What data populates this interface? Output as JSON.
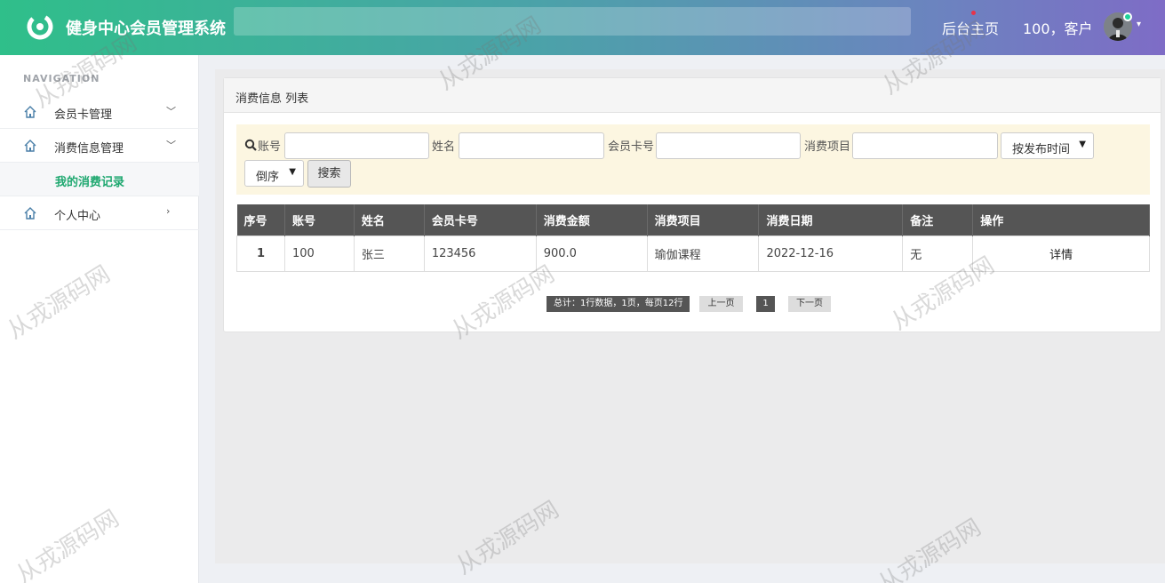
{
  "header": {
    "app_title": "健身中心会员管理系统",
    "home_link": "后台主页",
    "user_label": "100，客户"
  },
  "sidebar": {
    "heading": "NAVIGATION",
    "items": [
      {
        "label": "会员卡管理",
        "icon": "home-icon",
        "arrow": "chevron-down-icon"
      },
      {
        "label": "消费信息管理",
        "icon": "home-icon",
        "arrow": "chevron-down-icon"
      },
      {
        "label": "个人中心",
        "icon": "home-icon",
        "arrow": "chevron-right-icon"
      }
    ],
    "sub_items": [
      {
        "label": "我的消费记录"
      }
    ]
  },
  "panel": {
    "title": "消费信息 列表"
  },
  "search": {
    "fields": [
      {
        "label": "账号",
        "value": ""
      },
      {
        "label": "姓名",
        "value": ""
      },
      {
        "label": "会员卡号",
        "value": ""
      },
      {
        "label": "消费项目",
        "value": ""
      }
    ],
    "sort_select": "按发布时间",
    "order_select": "倒序",
    "button": "搜索"
  },
  "table": {
    "columns": [
      "序号",
      "账号",
      "姓名",
      "会员卡号",
      "消费金额",
      "消费项目",
      "消费日期",
      "备注",
      "操作"
    ],
    "rows": [
      {
        "index": "1",
        "account": "100",
        "name": "张三",
        "card_no": "123456",
        "amount": "900.0",
        "item": "瑜伽课程",
        "date": "2022-12-16",
        "remark": "无",
        "action": "详情"
      }
    ]
  },
  "pagination": {
    "total": "总计：1行数据，1页，每页12行",
    "prev": "上一页",
    "current": "1",
    "next": "下一页"
  },
  "watermark": "从戎源码网",
  "colors": {
    "accent": "#1fa870",
    "header_start": "#2fbf8a",
    "header_end": "#7e6cc6",
    "table_header": "#555555"
  }
}
